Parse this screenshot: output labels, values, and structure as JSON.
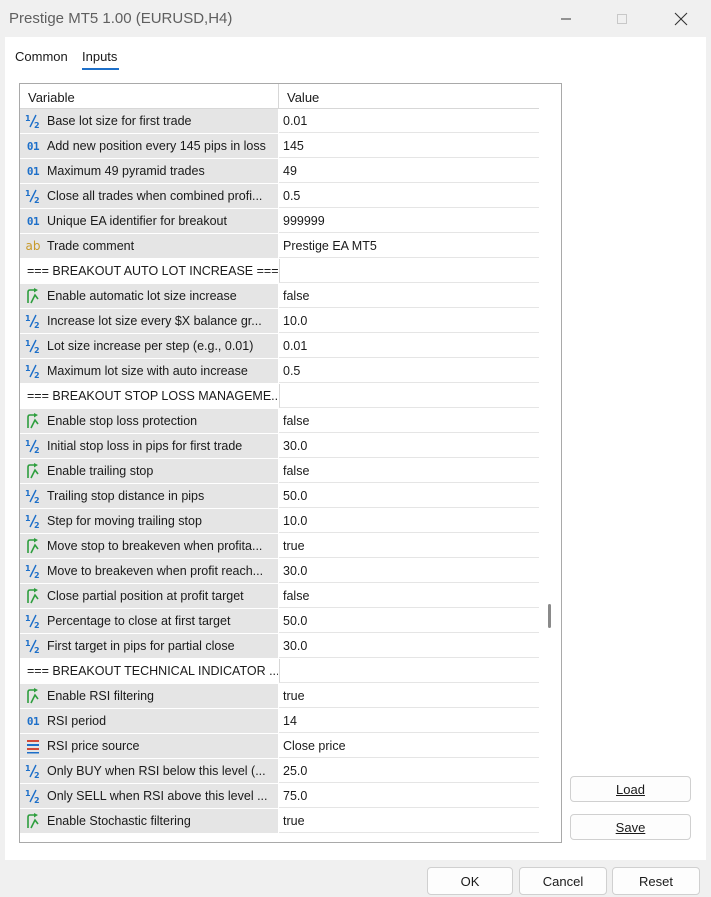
{
  "window": {
    "title": "Prestige MT5 1.00 (EURUSD,H4)"
  },
  "tabs": [
    {
      "label": "Common"
    },
    {
      "label": "Inputs"
    }
  ],
  "grid": {
    "header": {
      "variable": "Variable",
      "value": "Value"
    },
    "rows": [
      {
        "icon": "double",
        "label": "Base lot size for first trade",
        "value": "0.01"
      },
      {
        "icon": "int",
        "label": "Add new position every 145 pips in loss",
        "value": "145"
      },
      {
        "icon": "int",
        "label": "Maximum 49 pyramid trades",
        "value": "49"
      },
      {
        "icon": "double",
        "label": "Close all trades when combined profi...",
        "value": "0.5"
      },
      {
        "icon": "int",
        "label": "Unique EA identifier for breakout",
        "value": "999999"
      },
      {
        "icon": "string",
        "label": "Trade comment",
        "value": "Prestige EA MT5"
      },
      {
        "icon": "none",
        "label": "=== BREAKOUT AUTO LOT INCREASE ===",
        "value": ""
      },
      {
        "icon": "bool",
        "label": "Enable automatic lot size increase",
        "value": "false"
      },
      {
        "icon": "double",
        "label": "Increase lot size every $X balance gr...",
        "value": "10.0"
      },
      {
        "icon": "double",
        "label": "Lot size increase per step (e.g., 0.01)",
        "value": "0.01"
      },
      {
        "icon": "double",
        "label": "Maximum lot size with auto increase",
        "value": "0.5"
      },
      {
        "icon": "none",
        "label": "=== BREAKOUT STOP LOSS MANAGEME...",
        "value": ""
      },
      {
        "icon": "bool",
        "label": "Enable stop loss protection",
        "value": "false"
      },
      {
        "icon": "double",
        "label": "Initial stop loss in pips for first trade",
        "value": "30.0"
      },
      {
        "icon": "bool",
        "label": "Enable trailing stop",
        "value": "false"
      },
      {
        "icon": "double",
        "label": "Trailing stop distance in pips",
        "value": "50.0"
      },
      {
        "icon": "double",
        "label": "Step for moving trailing stop",
        "value": "10.0"
      },
      {
        "icon": "bool",
        "label": "Move stop to breakeven when profita...",
        "value": "true"
      },
      {
        "icon": "double",
        "label": "Move to breakeven when profit reach...",
        "value": "30.0"
      },
      {
        "icon": "bool",
        "label": "Close partial position at profit target",
        "value": "false"
      },
      {
        "icon": "double",
        "label": "Percentage to close at first target",
        "value": "50.0"
      },
      {
        "icon": "double",
        "label": "First target in pips for partial close",
        "value": "30.0"
      },
      {
        "icon": "none",
        "label": "=== BREAKOUT TECHNICAL INDICATOR ...",
        "value": ""
      },
      {
        "icon": "bool",
        "label": "Enable RSI filtering",
        "value": "true"
      },
      {
        "icon": "int",
        "label": "RSI period",
        "value": "14"
      },
      {
        "icon": "enum",
        "label": "RSI price source",
        "value": "Close price"
      },
      {
        "icon": "double",
        "label": "Only BUY when RSI below this level (...",
        "value": "25.0"
      },
      {
        "icon": "double",
        "label": "Only SELL when RSI above this level ...",
        "value": "75.0"
      },
      {
        "icon": "bool",
        "label": "Enable Stochastic filtering",
        "value": "true"
      }
    ]
  },
  "buttons": {
    "load": "Load",
    "save": "Save",
    "ok": "OK",
    "cancel": "Cancel",
    "reset": "Reset"
  },
  "icons": {
    "double_glyph": "½",
    "int_glyph": "01",
    "string_glyph": "ab"
  },
  "colors": {
    "accent": "#1d6fc9",
    "bool_icon": "#2e9e3e",
    "string_icon": "#c89a2a",
    "row_shade": "#e5e5e5"
  }
}
